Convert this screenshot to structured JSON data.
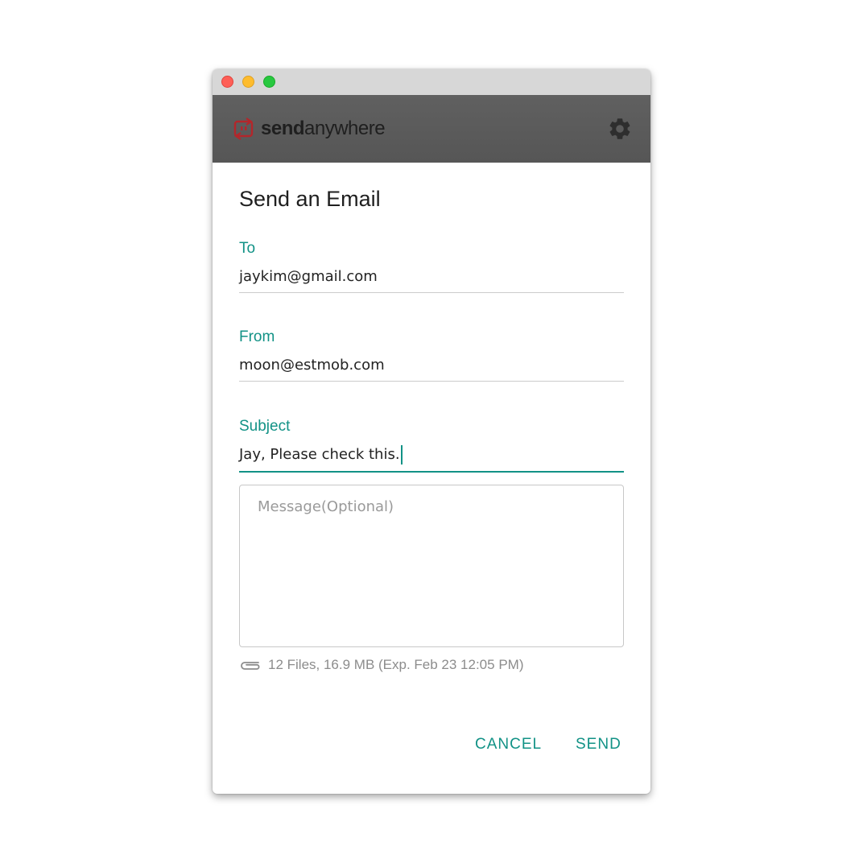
{
  "window": {
    "controls": [
      "close",
      "minimize",
      "maximize"
    ]
  },
  "app": {
    "logo_bold": "send",
    "logo_light": "anywhere",
    "logo_icon": "sendanywhere-logo-icon",
    "settings_icon": "gear-icon"
  },
  "dialog": {
    "title": "Send an Email",
    "to_label": "To",
    "to_value": "jaykim@gmail.com",
    "from_label": "From",
    "from_value": "moon@estmob.com",
    "subject_label": "Subject",
    "subject_value": "Jay, Please check this.",
    "message_placeholder": "Message(Optional)",
    "attachment_icon": "paperclip-icon",
    "attachment_info": "12 Files, 16.9 MB (Exp. Feb 23 12:05 PM)",
    "cancel_label": "CANCEL",
    "send_label": "SEND"
  },
  "colors": {
    "accent": "#129286",
    "appbar": "#5b5b5b",
    "logo_red": "#c0392b"
  }
}
